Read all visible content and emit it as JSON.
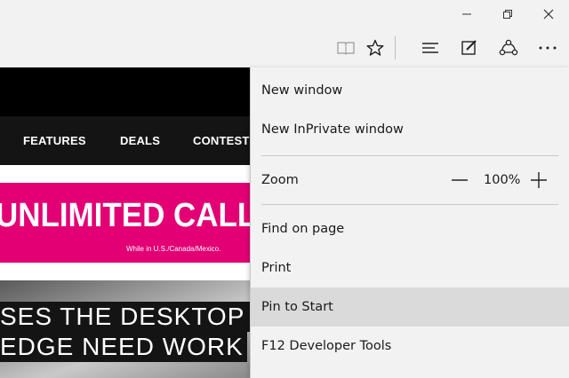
{
  "window_controls": {
    "minimize": "minimize-icon",
    "restore": "restore-icon",
    "close": "close-icon"
  },
  "toolbar": {
    "icons": [
      "reading-view-icon",
      "favorites-star-icon",
      "hub-icon",
      "web-note-icon",
      "share-icon",
      "more-actions-icon"
    ]
  },
  "page": {
    "nav": [
      "FEATURES",
      "DEALS",
      "CONTESTS"
    ],
    "banner": {
      "headline": "UNLIMITED CALLS",
      "note": "While in U.S./Canada/Mexico."
    },
    "article": {
      "line1": "SES THE DESKTOP TO",
      "line2": "EDGE NEED WORK"
    },
    "colors": {
      "accent": "#e20074",
      "nav_bg": "#141414"
    }
  },
  "menu": {
    "new_window": "New window",
    "new_inprivate": "New InPrivate window",
    "zoom_label": "Zoom",
    "zoom_value": "100%",
    "find": "Find on page",
    "print": "Print",
    "pin": "Pin to Start",
    "devtools": "F12 Developer Tools"
  }
}
